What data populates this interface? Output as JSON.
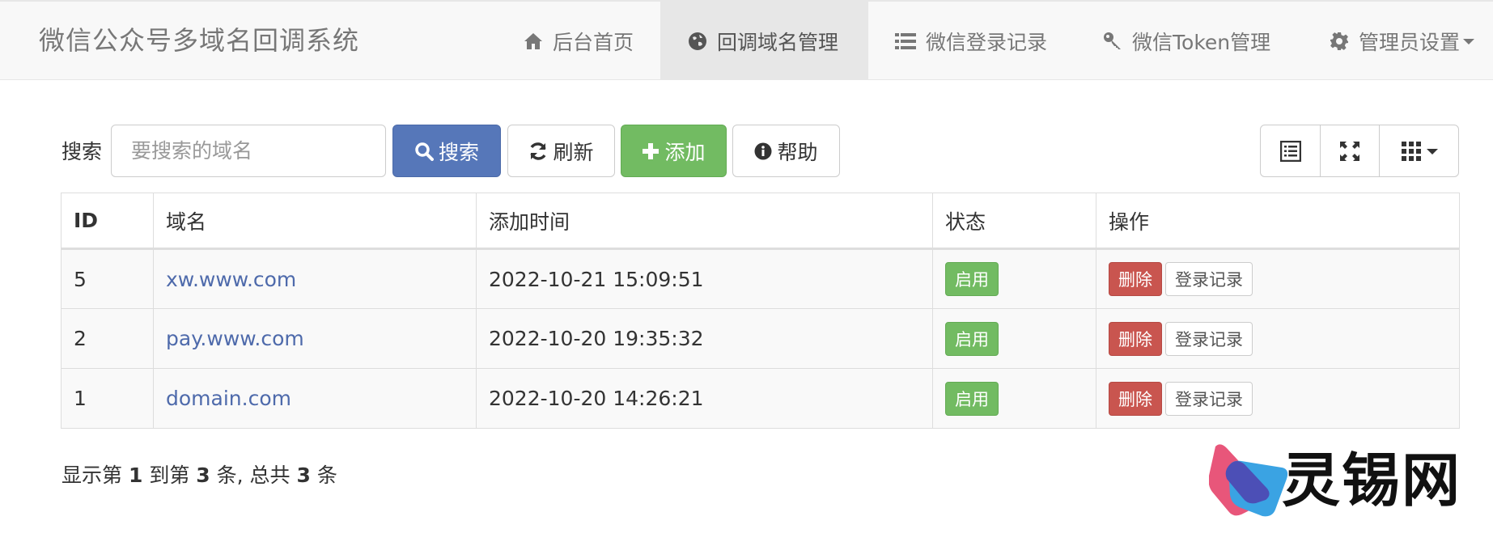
{
  "app": {
    "title": "微信公众号多域名回调系统"
  },
  "nav": {
    "items": [
      {
        "label": "后台首页",
        "icon": "home-icon",
        "active": false
      },
      {
        "label": "回调域名管理",
        "icon": "globe-icon",
        "active": true
      },
      {
        "label": "微信登录记录",
        "icon": "list-icon",
        "active": false
      },
      {
        "label": "微信Token管理",
        "icon": "key-icon",
        "active": false
      },
      {
        "label": "管理员设置",
        "icon": "gear-icon",
        "active": false
      }
    ]
  },
  "toolbar": {
    "search_label": "搜索",
    "search_placeholder": "要搜索的域名",
    "search_button": "搜索",
    "refresh_button": "刷新",
    "add_button": "添加",
    "help_button": "帮助"
  },
  "table": {
    "columns": [
      "ID",
      "域名",
      "添加时间",
      "状态",
      "操作"
    ],
    "rows": [
      {
        "id": "5",
        "domain": "xw.www.com",
        "time": "2022-10-21 15:09:51",
        "status": "启用",
        "delete": "删除",
        "log": "登录记录"
      },
      {
        "id": "2",
        "domain": "pay.www.com",
        "time": "2022-10-20 19:35:32",
        "status": "启用",
        "delete": "删除",
        "log": "登录记录"
      },
      {
        "id": "1",
        "domain": "domain.com",
        "time": "2022-10-20 14:26:21",
        "status": "启用",
        "delete": "删除",
        "log": "登录记录"
      }
    ]
  },
  "pagination": {
    "prefix": "显示第",
    "from": "1",
    "mid1": "到第",
    "to": "3",
    "mid2": "条, 总共",
    "total": "3",
    "suffix": "条"
  },
  "watermark": {
    "text": "灵锡网"
  },
  "colors": {
    "primary": "#5677b9",
    "success": "#72bb62",
    "danger": "#c9554f",
    "link": "#4e6aab"
  }
}
